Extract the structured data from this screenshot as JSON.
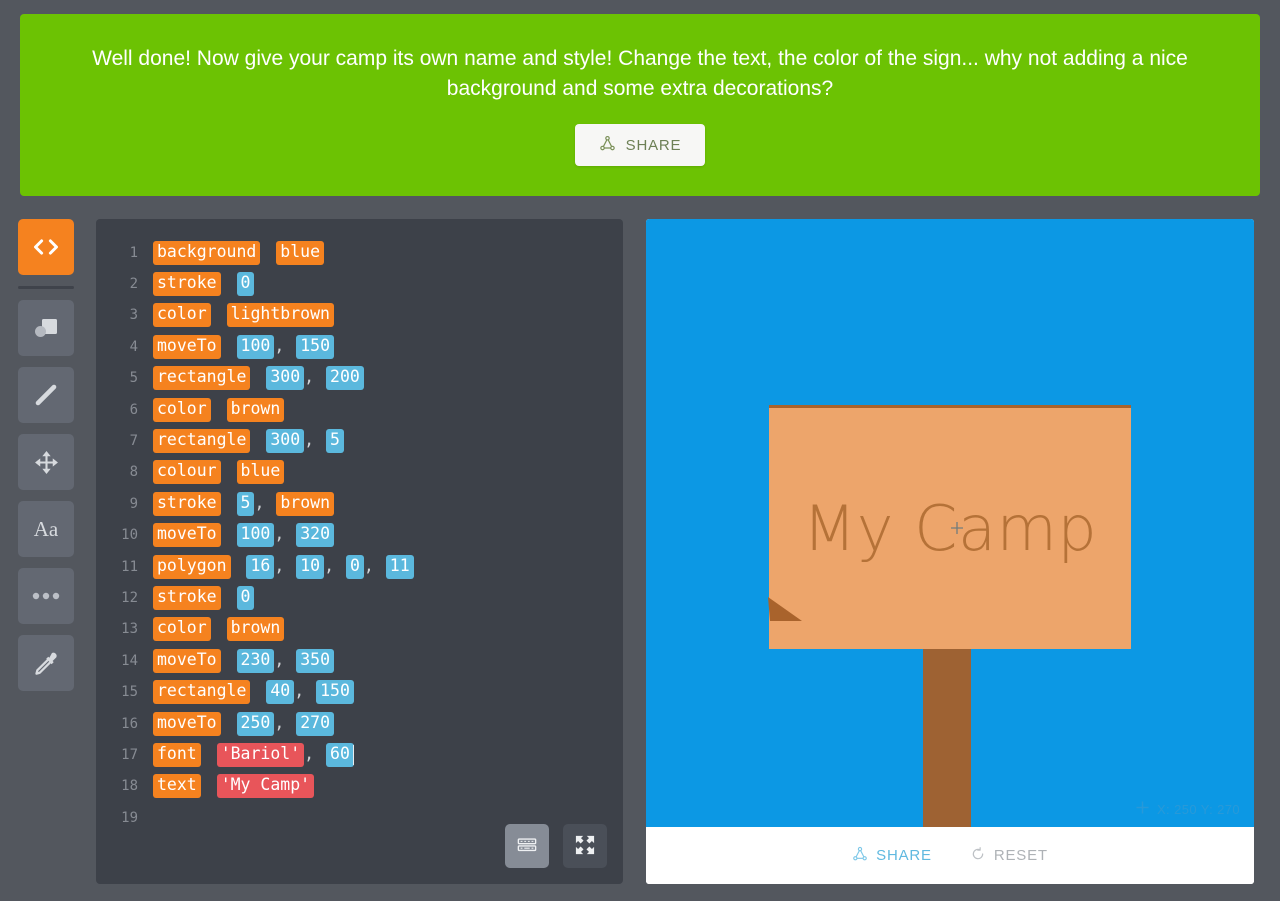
{
  "banner": {
    "message": "Well done! Now give your camp its own name and style! Change the text, the color of the sign... why not adding a nice background and some extra decorations?",
    "share_label": "SHARE",
    "share_icon": "share-icon",
    "background_color": "#6cc203"
  },
  "toolbar": {
    "items": [
      {
        "name": "code-tool",
        "icon": "code-brackets-icon",
        "active": true
      },
      {
        "name": "shapes-tool",
        "icon": "shapes-icon",
        "active": false
      },
      {
        "name": "line-tool",
        "icon": "line-icon",
        "active": false
      },
      {
        "name": "move-tool",
        "icon": "move-arrows-icon",
        "active": false
      },
      {
        "name": "text-tool",
        "icon": "text-aa-icon",
        "label": "Aa",
        "active": false
      },
      {
        "name": "more-tool",
        "icon": "ellipsis-icon",
        "active": false
      },
      {
        "name": "eyedropper-tool",
        "icon": "eyedropper-icon",
        "active": false
      }
    ],
    "active_color": "#f5821f",
    "inactive_color": "#636872"
  },
  "editor": {
    "lines": [
      {
        "n": "1",
        "tokens": [
          {
            "t": "background",
            "k": "kw"
          },
          {
            "t": " ",
            "k": "sp"
          },
          {
            "t": "blue",
            "k": "kw"
          }
        ]
      },
      {
        "n": "2",
        "tokens": [
          {
            "t": "stroke",
            "k": "kw"
          },
          {
            "t": " ",
            "k": "sp"
          },
          {
            "t": "0",
            "k": "num"
          }
        ]
      },
      {
        "n": "3",
        "tokens": [
          {
            "t": "color",
            "k": "kw"
          },
          {
            "t": " ",
            "k": "sp"
          },
          {
            "t": "lightbrown",
            "k": "kw"
          }
        ]
      },
      {
        "n": "4",
        "tokens": [
          {
            "t": "moveTo",
            "k": "kw"
          },
          {
            "t": " ",
            "k": "sp"
          },
          {
            "t": "100",
            "k": "num"
          },
          {
            "t": ", ",
            "k": "sep"
          },
          {
            "t": "150",
            "k": "num"
          }
        ]
      },
      {
        "n": "5",
        "tokens": [
          {
            "t": "rectangle",
            "k": "kw"
          },
          {
            "t": " ",
            "k": "sp"
          },
          {
            "t": "300",
            "k": "num"
          },
          {
            "t": ", ",
            "k": "sep"
          },
          {
            "t": "200",
            "k": "num"
          }
        ]
      },
      {
        "n": "6",
        "tokens": [
          {
            "t": "color",
            "k": "kw"
          },
          {
            "t": " ",
            "k": "sp"
          },
          {
            "t": "brown",
            "k": "kw"
          }
        ]
      },
      {
        "n": "7",
        "tokens": [
          {
            "t": "rectangle",
            "k": "kw"
          },
          {
            "t": " ",
            "k": "sp"
          },
          {
            "t": "300",
            "k": "num"
          },
          {
            "t": ", ",
            "k": "sep"
          },
          {
            "t": "5",
            "k": "num"
          }
        ]
      },
      {
        "n": "8",
        "tokens": [
          {
            "t": "colour",
            "k": "kw"
          },
          {
            "t": " ",
            "k": "sp"
          },
          {
            "t": "blue",
            "k": "kw"
          }
        ]
      },
      {
        "n": "9",
        "tokens": [
          {
            "t": "stroke",
            "k": "kw"
          },
          {
            "t": " ",
            "k": "sp"
          },
          {
            "t": "5",
            "k": "num"
          },
          {
            "t": ", ",
            "k": "sep"
          },
          {
            "t": "brown",
            "k": "kw"
          }
        ]
      },
      {
        "n": "10",
        "tokens": [
          {
            "t": "moveTo",
            "k": "kw"
          },
          {
            "t": " ",
            "k": "sp"
          },
          {
            "t": "100",
            "k": "num"
          },
          {
            "t": ", ",
            "k": "sep"
          },
          {
            "t": "320",
            "k": "num"
          }
        ]
      },
      {
        "n": "11",
        "tokens": [
          {
            "t": "polygon",
            "k": "kw"
          },
          {
            "t": " ",
            "k": "sp"
          },
          {
            "t": "16",
            "k": "num"
          },
          {
            "t": ", ",
            "k": "sep"
          },
          {
            "t": "10",
            "k": "num"
          },
          {
            "t": ", ",
            "k": "sep"
          },
          {
            "t": "0",
            "k": "num"
          },
          {
            "t": ", ",
            "k": "sep"
          },
          {
            "t": "11",
            "k": "num"
          }
        ]
      },
      {
        "n": "12",
        "tokens": [
          {
            "t": "stroke",
            "k": "kw"
          },
          {
            "t": " ",
            "k": "sp"
          },
          {
            "t": "0",
            "k": "num"
          }
        ]
      },
      {
        "n": "13",
        "tokens": [
          {
            "t": "color",
            "k": "kw"
          },
          {
            "t": " ",
            "k": "sp"
          },
          {
            "t": "brown",
            "k": "kw"
          }
        ]
      },
      {
        "n": "14",
        "tokens": [
          {
            "t": "moveTo",
            "k": "kw"
          },
          {
            "t": " ",
            "k": "sp"
          },
          {
            "t": "230",
            "k": "num"
          },
          {
            "t": ", ",
            "k": "sep"
          },
          {
            "t": "350",
            "k": "num"
          }
        ]
      },
      {
        "n": "15",
        "tokens": [
          {
            "t": "rectangle",
            "k": "kw"
          },
          {
            "t": " ",
            "k": "sp"
          },
          {
            "t": "40",
            "k": "num"
          },
          {
            "t": ", ",
            "k": "sep"
          },
          {
            "t": "150",
            "k": "num"
          }
        ]
      },
      {
        "n": "16",
        "tokens": [
          {
            "t": "moveTo",
            "k": "kw"
          },
          {
            "t": " ",
            "k": "sp"
          },
          {
            "t": "250",
            "k": "num"
          },
          {
            "t": ", ",
            "k": "sep"
          },
          {
            "t": "270",
            "k": "num"
          }
        ]
      },
      {
        "n": "17",
        "tokens": [
          {
            "t": "font",
            "k": "kw"
          },
          {
            "t": " ",
            "k": "sp"
          },
          {
            "t": "'Bariol'",
            "k": "str"
          },
          {
            "t": ", ",
            "k": "sep"
          },
          {
            "t": "60",
            "k": "num",
            "caret": true
          }
        ]
      },
      {
        "n": "18",
        "tokens": [
          {
            "t": "text",
            "k": "kw"
          },
          {
            "t": " ",
            "k": "sp"
          },
          {
            "t": "'My Camp'",
            "k": "str"
          }
        ]
      },
      {
        "n": "19",
        "tokens": []
      }
    ],
    "buttons": [
      {
        "name": "keyboard-button",
        "icon": "keyboard-icon",
        "highlighted": true
      },
      {
        "name": "fullscreen-button",
        "icon": "fullscreen-icon",
        "highlighted": false
      }
    ],
    "colors": {
      "keyword": "#f5821f",
      "number": "#5bb8dd",
      "string": "#e8555a",
      "background": "#3d4149"
    }
  },
  "canvas": {
    "background_color": "#0c98e4",
    "sign_text": "My Camp",
    "sign_color": "#eda56b",
    "post_color": "#9e6233",
    "coords_label": "X: 250 Y: 270",
    "coords_icon": "crosshair-icon",
    "share_label": "SHARE",
    "share_icon": "share-icon",
    "reset_label": "RESET",
    "reset_icon": "refresh-icon"
  }
}
